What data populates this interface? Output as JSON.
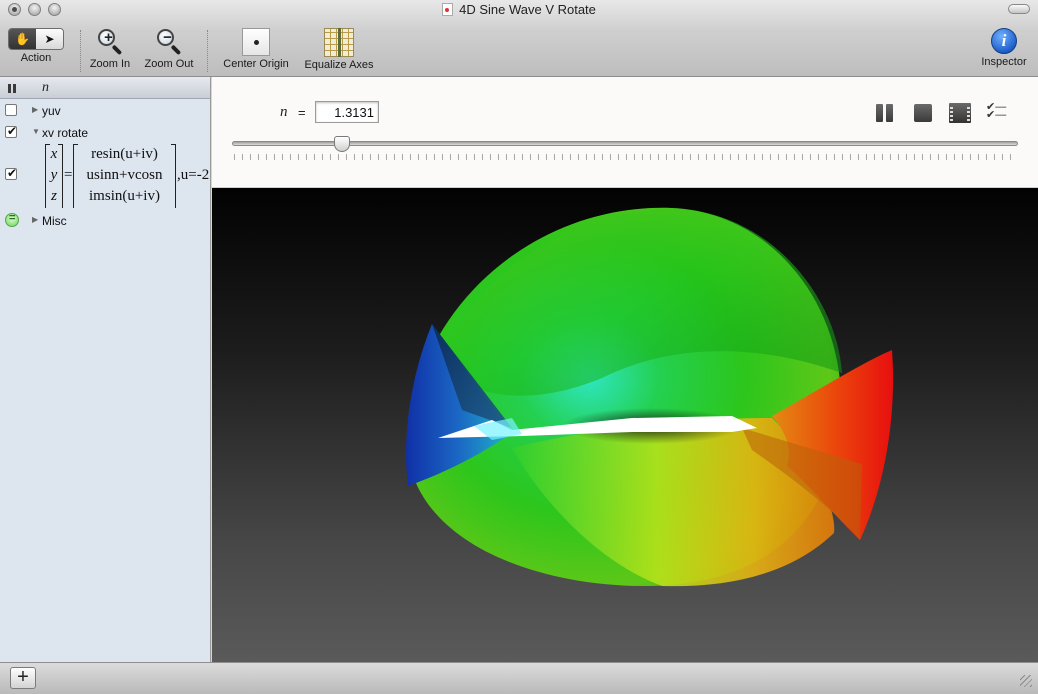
{
  "window": {
    "title": "4D Sine Wave V Rotate"
  },
  "toolbar": {
    "action_label": "Action",
    "zoom_in_label": "Zoom In",
    "zoom_out_label": "Zoom Out",
    "center_origin_label": "Center Origin",
    "equalize_axes_label": "Equalize Axes",
    "inspector_label": "Inspector"
  },
  "sidebar": {
    "header_variable": "n",
    "items": [
      {
        "label": "yuv",
        "checked": false,
        "expanded": false
      },
      {
        "label": "xv rotate",
        "checked": true,
        "expanded": true
      },
      {
        "label": "Misc",
        "checked": null,
        "expanded": false
      }
    ],
    "equation": {
      "left": [
        "x",
        "y",
        "z"
      ],
      "right": [
        "resin(u+iv)",
        "usinn+vcosn",
        "imsin(u+iv)"
      ],
      "tail": ",u=-2"
    }
  },
  "controls": {
    "variable": "n",
    "equals": "=",
    "value": "1.3131",
    "slider_fraction": 0.14
  },
  "view": {
    "background_top": "#020202",
    "background_bottom": "#5a5a5a"
  },
  "icons": {
    "add": "plus-icon",
    "pause": "pause-icon",
    "stop": "stop-icon",
    "movie": "film-icon",
    "checklist": "checklist-icon",
    "inspector": "info-icon"
  }
}
